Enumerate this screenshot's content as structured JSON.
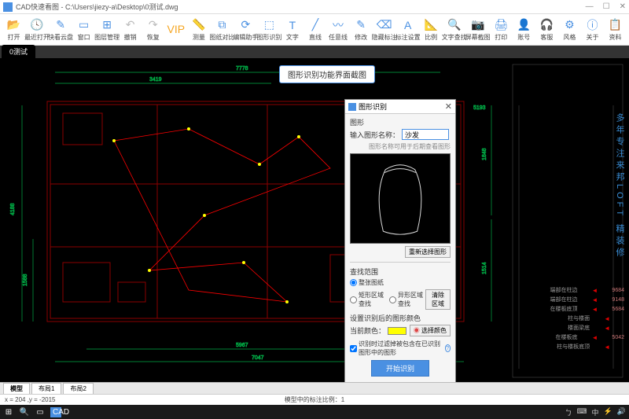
{
  "title": "CAD快速看图 - C:\\Users\\jiezy-a\\Desktop\\0测试.dwg",
  "win": {
    "min": "—",
    "max": "☐",
    "close": "✕"
  },
  "toolbar": [
    {
      "icon": "📂",
      "label": "打开",
      "c": "#4a90e2"
    },
    {
      "icon": "🕓",
      "label": "最近打开",
      "c": "#4a90e2"
    },
    {
      "icon": "✎",
      "label": "快看云盘",
      "c": "#4a90e2"
    },
    {
      "icon": "▭",
      "label": "窗口",
      "c": "#4a90e2"
    },
    {
      "icon": "⊞",
      "label": "图层管理",
      "c": "#4a90e2"
    },
    {
      "icon": "↶",
      "label": "撤销",
      "c": "#bbb"
    },
    {
      "icon": "↷",
      "label": "恢复",
      "c": "#bbb"
    },
    {
      "icon": "VIP",
      "label": "",
      "c": "#f5a623"
    },
    {
      "icon": "📏",
      "label": "测量",
      "c": "#4a90e2"
    },
    {
      "icon": "⧉",
      "label": "图纸对比",
      "c": "#4a90e2"
    },
    {
      "icon": "⟳",
      "label": "编辑助手",
      "c": "#4a90e2"
    },
    {
      "icon": "⬚",
      "label": "图形识别",
      "c": "#4a90e2"
    },
    {
      "icon": "T",
      "label": "文字",
      "c": "#4a90e2"
    },
    {
      "icon": "╱",
      "label": "直线",
      "c": "#4a90e2"
    },
    {
      "icon": "〰",
      "label": "任意线",
      "c": "#4a90e2"
    },
    {
      "icon": "✎",
      "label": "修改",
      "c": "#4a90e2"
    },
    {
      "icon": "⌫",
      "label": "隐藏标注",
      "c": "#4a90e2"
    },
    {
      "icon": "A",
      "label": "标注设置",
      "c": "#4a90e2"
    },
    {
      "icon": "📐",
      "label": "比例",
      "c": "#4a90e2"
    },
    {
      "icon": "🔍",
      "label": "文字查找",
      "c": "#4a90e2"
    },
    {
      "icon": "📷",
      "label": "屏幕截图",
      "c": "#4a90e2"
    },
    {
      "icon": "🖨",
      "label": "打印",
      "c": "#4a90e2"
    },
    {
      "icon": "👤",
      "label": "账号",
      "c": "#4a90e2"
    },
    {
      "icon": "🎧",
      "label": "客服",
      "c": "#4a90e2"
    },
    {
      "icon": "⚙",
      "label": "风格",
      "c": "#4a90e2"
    },
    {
      "icon": "ⓘ",
      "label": "关于",
      "c": "#4a90e2"
    },
    {
      "icon": "📋",
      "label": "资料",
      "c": "#4a90e2"
    }
  ],
  "tab_active": "0测试",
  "callout": "图形识别功能界面截图",
  "dialog": {
    "title": "图形识别",
    "section_shape": "图形",
    "name_label": "输入图形名称：",
    "name_value": "沙发",
    "name_hint": "图形名称可用于后期查看图形",
    "reselect_btn": "重新选择图形",
    "scope_title": "查找范围",
    "opt_whole": "整张图纸",
    "opt_rect": "矩形区域查找",
    "opt_irr": "异形区域查找",
    "clear_btn": "清除区域",
    "color_title": "设置识别后的图形颜色",
    "color_label": "当前颜色：",
    "pick_color": "选择颜色",
    "checkbox": "识别时过滤掉被包含在已识别图形中的图形",
    "start_btn": "开始识别"
  },
  "right_text": "多年专注来邦LOFT 精装修",
  "dims": {
    "top": "7778",
    "t2": "3419",
    "left": "4188",
    "l2": "1588",
    "bottom": "5967",
    "b2": "7047",
    "r1": "5193",
    "r2": "1848",
    "r3": "1514"
  },
  "legend": [
    {
      "t": "端部在柱边",
      "n": "9684"
    },
    {
      "t": "端部在柱边",
      "n": "9148"
    },
    {
      "t": "在楼板底顶",
      "n": "5684"
    },
    {
      "t": "柱与楼面",
      "n": ""
    },
    {
      "t": "楼面梁底",
      "n": ""
    },
    {
      "t": "在楼板底",
      "n": "5042"
    },
    {
      "t": "柱与楼板底顶",
      "n": ""
    }
  ],
  "bottom_tabs": [
    "模型",
    "布局1",
    "布局2"
  ],
  "status_coord": "x = 204 ,y = -2015",
  "status_center": "模型中的标注比例：1",
  "taskbar_right": [
    "ㄅ",
    "⌨",
    "中",
    "⚡",
    "🔊"
  ]
}
